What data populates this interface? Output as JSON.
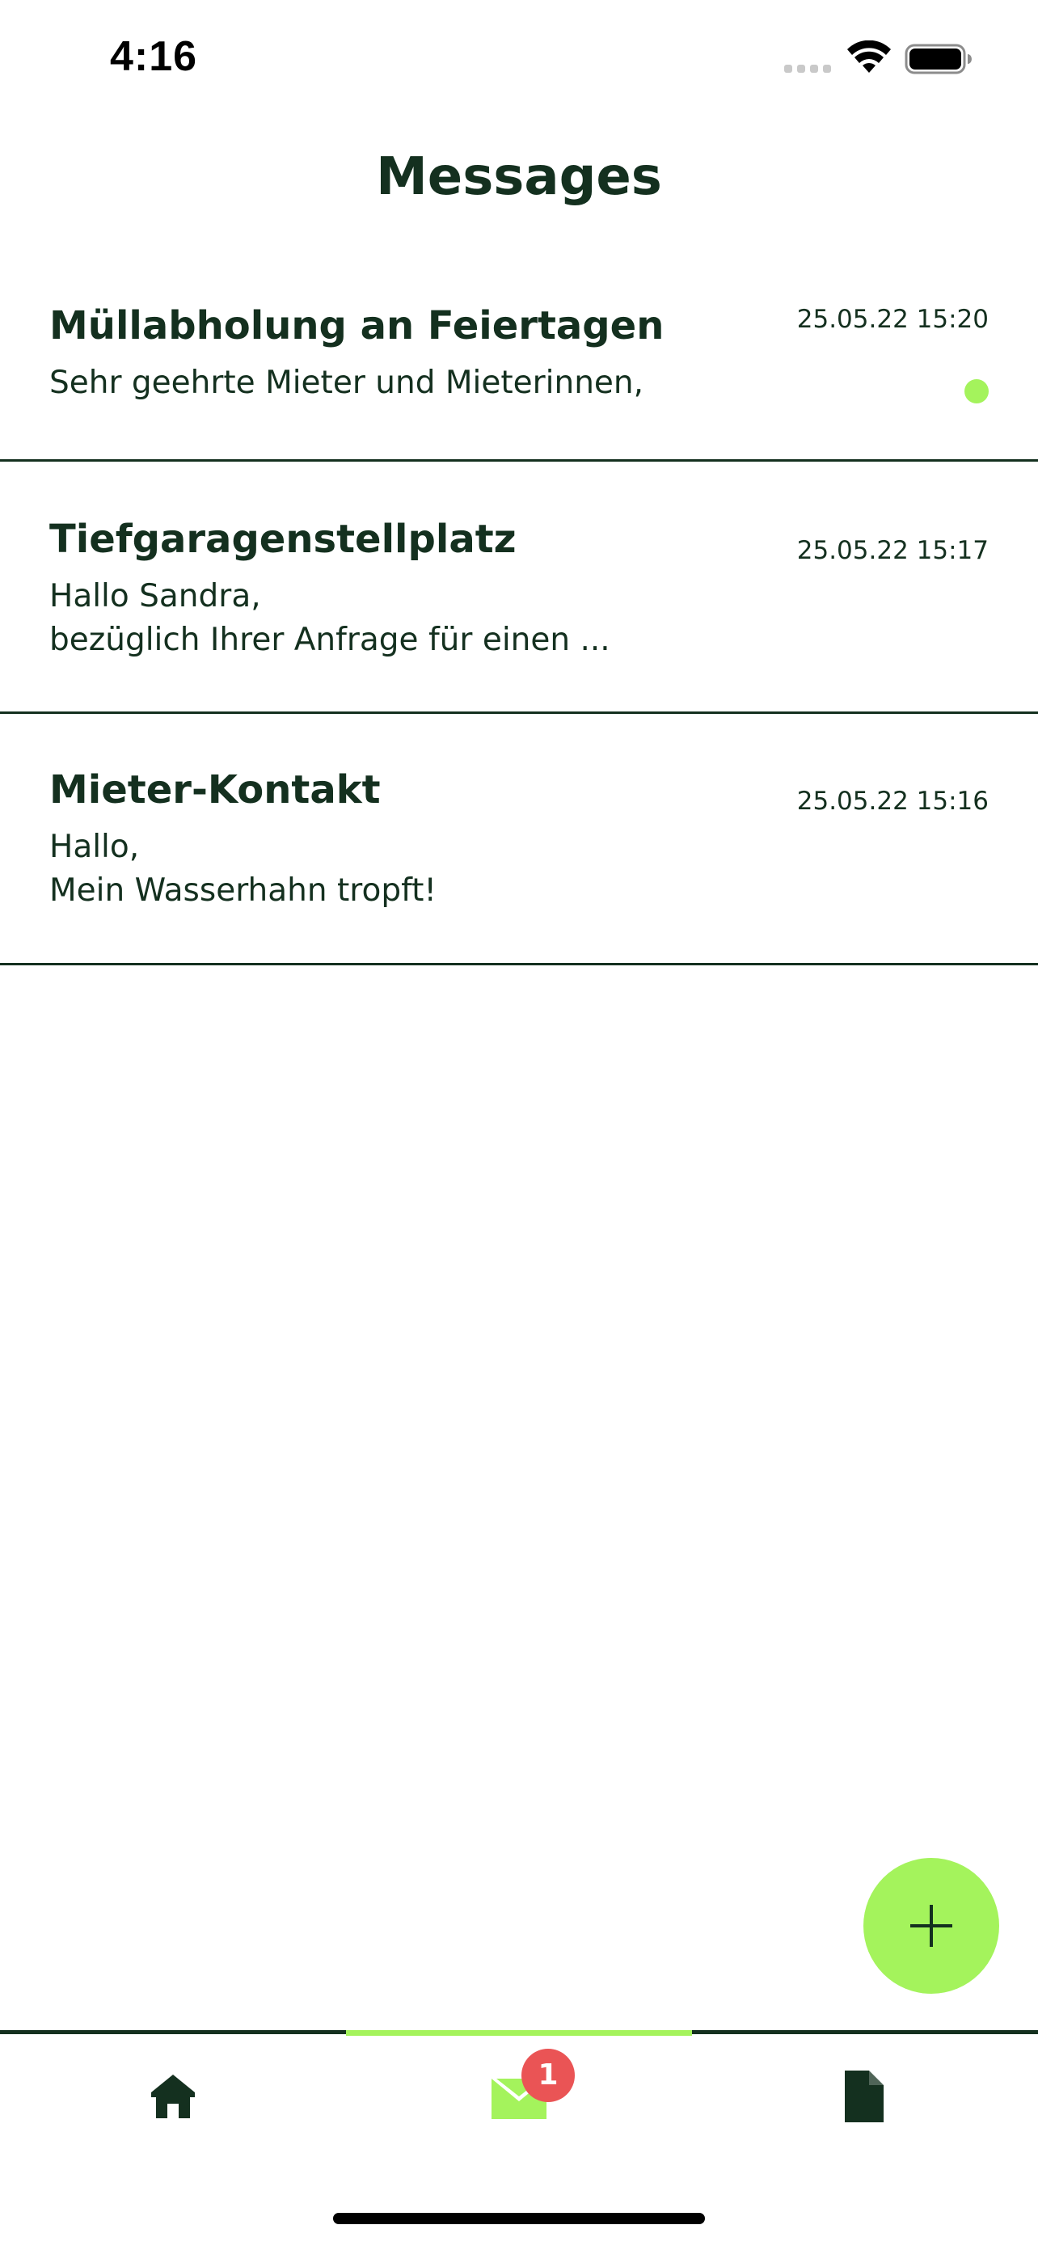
{
  "status_bar": {
    "time": "4:16"
  },
  "header": {
    "title": "Messages"
  },
  "messages": [
    {
      "title": "Müllabholung an Feiertagen",
      "date": "25.05.22 15:20",
      "preview_lines": [
        "Sehr geehrte Mieter und Mieterinnen,"
      ],
      "unread": true
    },
    {
      "title": "Tiefgaragenstellplatz",
      "date": "25.05.22 15:17",
      "preview_lines": [
        "Hallo Sandra,",
        "bezüglich Ihrer Anfrage für einen ..."
      ],
      "unread": false
    },
    {
      "title": "Mieter-Kontakt",
      "date": "25.05.22 15:16",
      "preview_lines": [
        "Hallo,",
        "Mein Wasserhahn tropft!"
      ],
      "unread": false
    }
  ],
  "fab": {
    "icon": "plus-icon"
  },
  "tab_bar": {
    "tabs": [
      {
        "icon": "home-icon",
        "active": false
      },
      {
        "icon": "mail-icon",
        "active": true,
        "badge": "1"
      },
      {
        "icon": "document-icon",
        "active": false
      }
    ]
  },
  "colors": {
    "primary_dark": "#14301f",
    "accent_green": "#a4f35c",
    "badge_red": "#ea5455"
  }
}
